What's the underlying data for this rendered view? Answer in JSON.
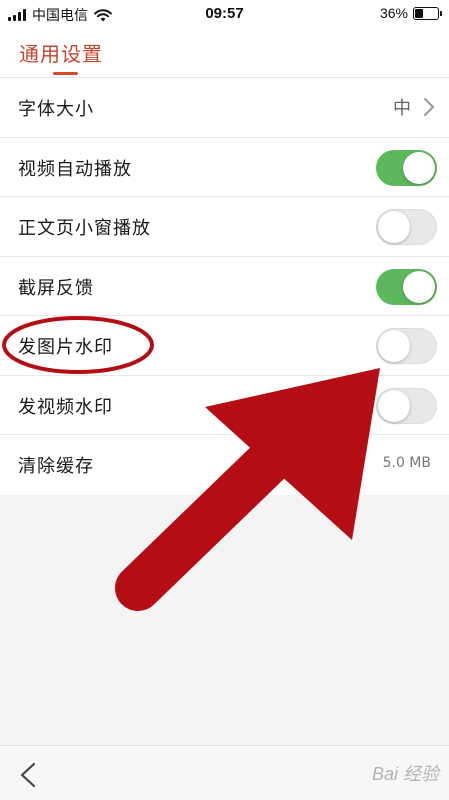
{
  "status_bar": {
    "carrier": "中国电信",
    "time": "09:57",
    "battery": "36%",
    "battery_level": 0.36
  },
  "header": {
    "title": "通用设置"
  },
  "settings": {
    "font_size": {
      "label": "字体大小",
      "value": "中"
    },
    "video_autoplay": {
      "label": "视频自动播放",
      "state": "on"
    },
    "article_mini_window": {
      "label": "正文页小窗播放",
      "state": "off"
    },
    "screenshot_feedback": {
      "label": "截屏反馈",
      "state": "on"
    },
    "image_watermark": {
      "label": "发图片水印",
      "state": "off"
    },
    "video_watermark": {
      "label": "发视频水印",
      "state": "off"
    },
    "clear_cache": {
      "label": "清除缓存",
      "value": "5.0 MB"
    }
  },
  "watermark": {
    "text": "Bai 经验"
  },
  "colors": {
    "accent": "#c9452b",
    "toggle_on": "#5cb85c",
    "annotation": "#b50d14"
  },
  "icons": {
    "back": "chevron-left-icon",
    "row_arrow": "chevron-right-icon",
    "wifi": "wifi-icon",
    "battery": "battery-icon"
  }
}
